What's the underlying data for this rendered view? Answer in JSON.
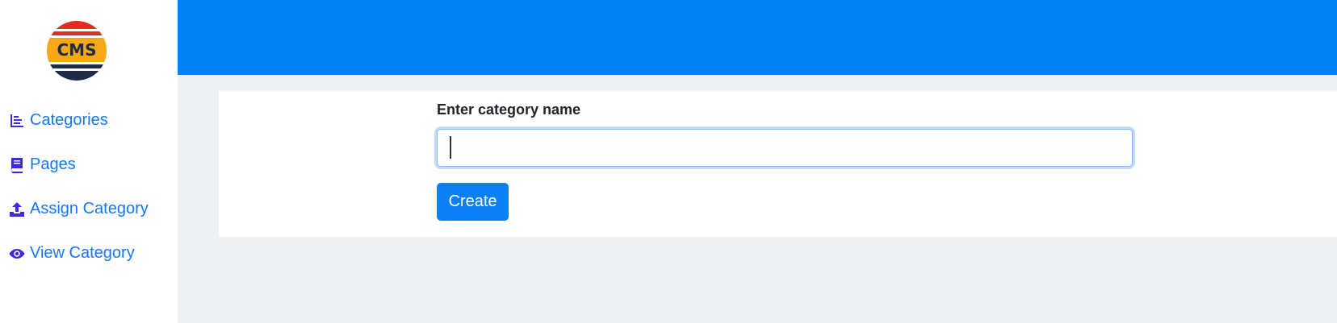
{
  "brand": {
    "logo_text": "CMS"
  },
  "sidebar": {
    "items": [
      {
        "label": "Categories",
        "icon": "list-chart-icon"
      },
      {
        "label": "Pages",
        "icon": "book-icon"
      },
      {
        "label": "Assign Category",
        "icon": "upload-icon"
      },
      {
        "label": "View Category",
        "icon": "eye-icon"
      }
    ]
  },
  "form": {
    "label": "Enter category name",
    "input_value": "",
    "submit_label": "Create"
  },
  "colors": {
    "accent": "#0183f6",
    "link": "#1677f6",
    "icon": "#3d2bd6",
    "background": "#eef1f4"
  }
}
